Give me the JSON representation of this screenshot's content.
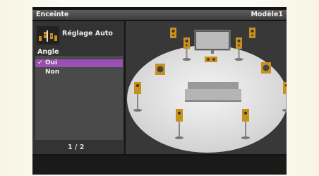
{
  "header": {
    "title": "Enceinte",
    "model": "Modèle1"
  },
  "setting": {
    "icon": "speakers-setup-icon",
    "label": "Réglage Auto"
  },
  "section": {
    "label": "Angle"
  },
  "options": [
    {
      "label": "Oui",
      "selected": true
    },
    {
      "label": "Non",
      "selected": false
    }
  ],
  "pager": {
    "text": "1 / 2"
  },
  "colors": {
    "selection": "#9a4fb4",
    "floor": "#e8e8e8",
    "speaker": "#c8901c"
  }
}
